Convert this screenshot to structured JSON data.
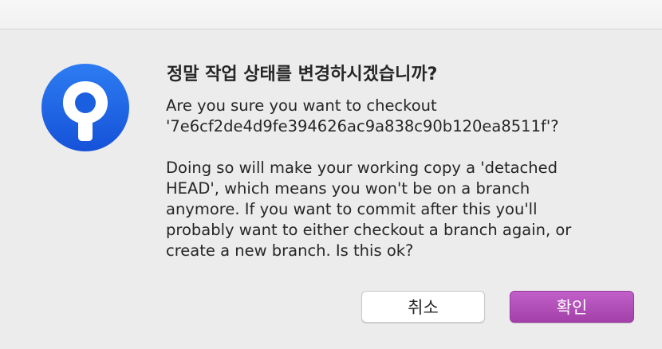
{
  "dialog": {
    "title": "정말 작업 상태를 변경하시겠습니까?",
    "message_line_1": "Are you sure you want to checkout\n'7e6cf2de4d9fe394626ac9a838c90b120ea8511f'?",
    "message_line_2": "Doing so will make your working copy a 'detached\nHEAD', which means you won't be on a branch\nanymore. If you want to commit after this you'll\nprobably want to either checkout a branch again, or\ncreate a new branch. Is this ok?",
    "cancel_label": "취소",
    "confirm_label": "확인",
    "icon": "sourcetree-app-icon"
  },
  "colors": {
    "app_icon_blue": "#1f66e5",
    "confirm_button": "#b14fb8",
    "background": "#ececec"
  }
}
